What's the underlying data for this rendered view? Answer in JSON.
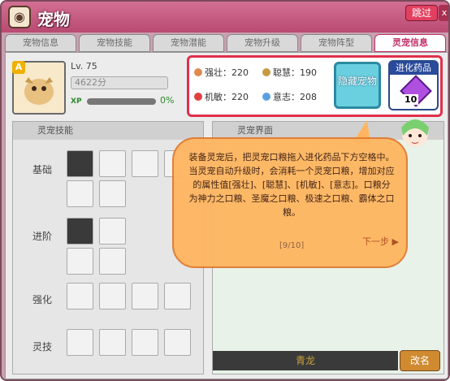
{
  "window": {
    "title": "宠物",
    "skip_label": "跳过",
    "close_label": "x"
  },
  "tabs": [
    {
      "label": "宠物信息",
      "active": false
    },
    {
      "label": "宠物技能",
      "active": false
    },
    {
      "label": "宠物潜能",
      "active": false
    },
    {
      "label": "宠物升级",
      "active": false
    },
    {
      "label": "宠物阵型",
      "active": false
    },
    {
      "label": "灵宠信息",
      "active": true
    }
  ],
  "pet": {
    "grade": "A",
    "level": "Lv. 75",
    "score": "4622分",
    "xp_label": "XP",
    "xp_value": "0%",
    "name": "青龙",
    "rename_label": "改名"
  },
  "stats": {
    "strength_label": "强壮",
    "strength_value": "220",
    "wisdom_label": "聪慧",
    "wisdom_value": "190",
    "agility_label": "机敏",
    "agility_value": "220",
    "will_label": "意志",
    "will_value": "208",
    "hide_pet_label": "隐藏宠物",
    "evo_label": "进化药品",
    "evo_count": "10"
  },
  "skills": {
    "header": "灵宠技能",
    "rows": [
      "基础",
      "进阶",
      "强化",
      "灵技"
    ]
  },
  "right_panel": {
    "header": "灵宠界面"
  },
  "tutorial": {
    "text": "装备灵宠后，把灵宠口粮拖入进化药品下方空格中。当灵宠自动升级时，会消耗一个灵宠口粮，增加对应的属性值[强壮]、[聪慧]、[机敏]、[意志]。口粮分为神力之口粮、圣魔之口粮、极速之口粮、霸体之口粮。",
    "page": "[9/10]",
    "next_label": "下一步"
  },
  "colors": {
    "title_bg": "#c0306a",
    "bubble": "#ffb560",
    "highlight_border": "#e0304a"
  }
}
